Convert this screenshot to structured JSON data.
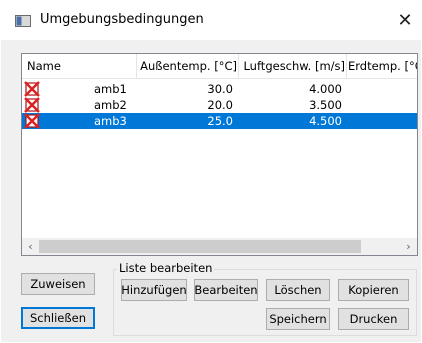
{
  "window": {
    "title": "Umgebungsbedingungen",
    "close_symbol": "✕"
  },
  "list": {
    "columns": [
      "Name",
      "Außentemp. [°C]",
      "Luftgeschw. [m/s]",
      "Erdtemp. [°C]"
    ],
    "rows": [
      {
        "name": "amb1",
        "aussentemp": "30.0",
        "luftgeschw": "4.000",
        "erdtemp": "",
        "selected": false
      },
      {
        "name": "amb2",
        "aussentemp": "20.0",
        "luftgeschw": "3.500",
        "erdtemp": "",
        "selected": false
      },
      {
        "name": "amb3",
        "aussentemp": "25.0",
        "luftgeschw": "4.500",
        "erdtemp": "",
        "selected": true
      }
    ],
    "row_icon": "red-cross-icon",
    "scroll_left": "‹",
    "scroll_right": "›"
  },
  "buttons": {
    "assign": "Zuweisen",
    "close": "Schließen"
  },
  "edit_group": {
    "label": "Liste bearbeiten",
    "add": "Hinzufügen",
    "edit": "Bearbeiten",
    "delete": "Löschen",
    "copy": "Kopieren",
    "save": "Speichern",
    "print": "Drucken"
  },
  "colors": {
    "selection": "#0078d7",
    "icon_red": "#e02020"
  }
}
